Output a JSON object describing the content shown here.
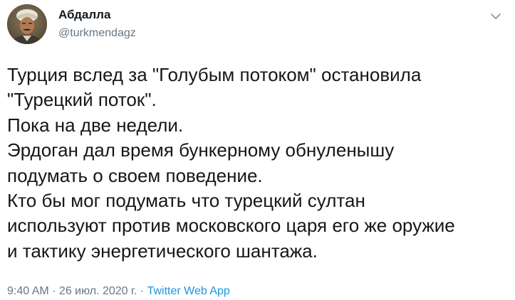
{
  "user": {
    "display_name": "Абдалла",
    "handle": "@turkmendagz",
    "avatar_icon": "user-avatar-photo"
  },
  "menu": {
    "icon": "chevron-down-icon"
  },
  "tweet": {
    "lines": [
      "Турция вслед за \"Голубым потоком\" остановила",
      "\"Турецкий поток\".",
      "Пока на две недели.",
      "Эрдоган дал время бункерному обнуленышу",
      "подумать о своем поведение.",
      "Кто бы мог подумать что турецкий султан",
      "используют против московского царя его же оружие",
      "и тактику энергетического шантажа."
    ]
  },
  "meta": {
    "time": "9:40 AM",
    "separator": " · ",
    "date": "26 июл. 2020 г.",
    "source": "Twitter Web App"
  },
  "colors": {
    "text": "#14171a",
    "secondary": "#657786",
    "link": "#1b95e0"
  }
}
